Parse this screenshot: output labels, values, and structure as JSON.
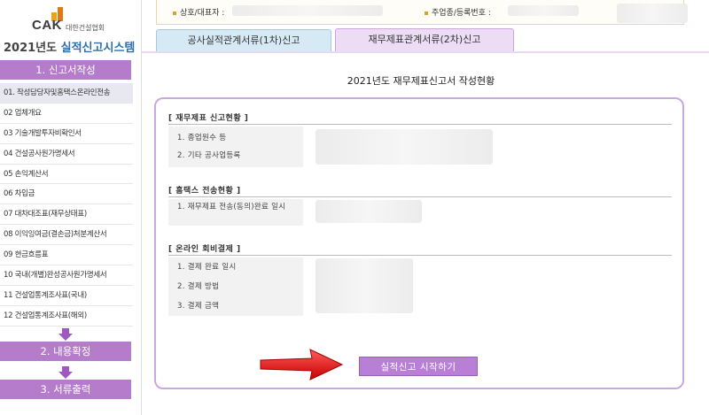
{
  "logo": {
    "brand": "CAK",
    "org_name": "대한건설협회"
  },
  "system_title": {
    "year": "2021년도",
    "name": "실적신고시스템"
  },
  "steps": [
    {
      "label": "1. 신고서작성"
    },
    {
      "label": "2. 내용확정"
    },
    {
      "label": "3. 서류출력"
    }
  ],
  "menu": [
    {
      "label": "01. 작성담당자및홈택스온라인전송"
    },
    {
      "label": "02 업체개요"
    },
    {
      "label": "03 기술개발투자비확인서"
    },
    {
      "label": "04 건설공사원가명세서"
    },
    {
      "label": "05 손익계산서"
    },
    {
      "label": "06 차입금"
    },
    {
      "label": "07 대차대조표(재무상태표)"
    },
    {
      "label": "08 이익잉여금(결손금)처분계산서"
    },
    {
      "label": "09 현금흐름표"
    },
    {
      "label": "10 국내(개별)완성공사원가명세서"
    },
    {
      "label": "11 건설업통계조사표(국내)"
    },
    {
      "label": "12 건설업통계조사표(해외)"
    }
  ],
  "infobar": {
    "company_label": "상호/대표자 :",
    "business_label": "주업종/등록번호 :"
  },
  "tabs": [
    {
      "label": "공사실적관계서류(1차)신고"
    },
    {
      "label": "재무제표관계서류(2차)신고"
    }
  ],
  "main": {
    "title": "2021년도 재무제표신고서 작성현황",
    "sections": [
      {
        "title": "[ 재무제표 신고현황 ]",
        "rows": [
          "1. 종업원수 등",
          "2. 기타 공사업등록"
        ]
      },
      {
        "title": "[ 홈택스 전송현황 ]",
        "rows": [
          "1. 재무제표 전송(동의)완료 일시"
        ]
      },
      {
        "title": "[ 온라인 회비결제 ]",
        "rows": [
          "1. 결제 완료 일시",
          "2. 결제 방법",
          "3. 결제 금액"
        ]
      }
    ],
    "start_button": "실적신고 시작하기"
  },
  "colors": {
    "accent_purple": "#b57ccc",
    "tab_blue": "#d6eaf6",
    "tab_purple": "#ecdcf4",
    "arrow_red": "#e02020",
    "logo_orange": "#e07a10"
  }
}
